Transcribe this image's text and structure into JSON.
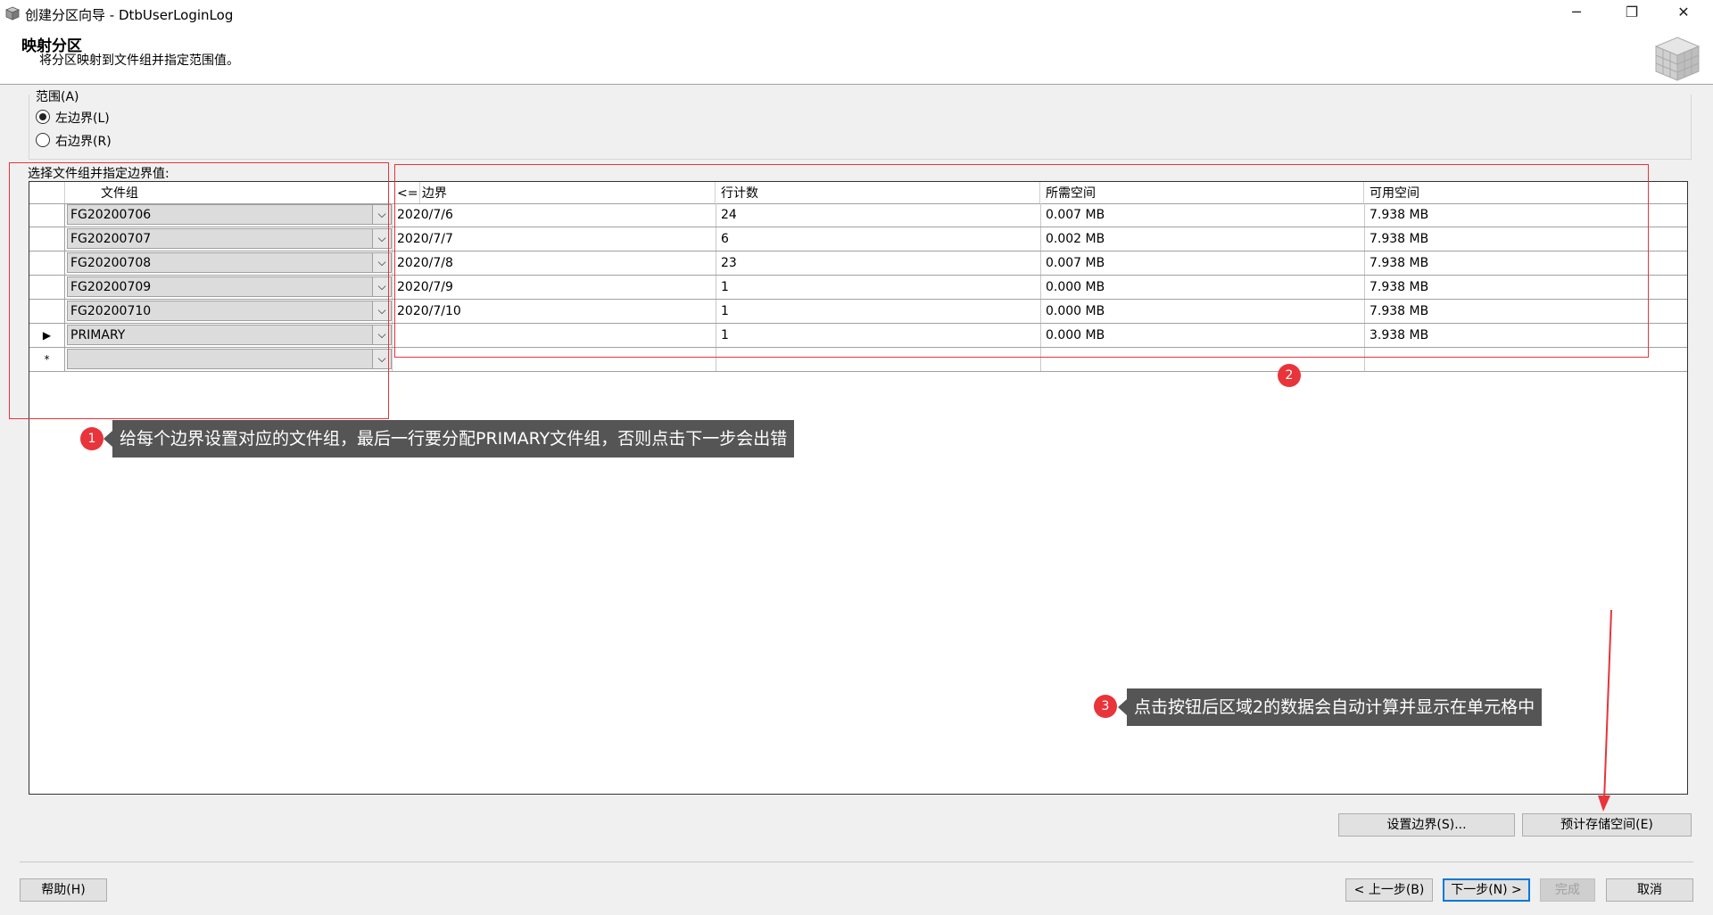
{
  "window": {
    "title": "创建分区向导 - DtbUserLoginLog",
    "minimize": "─",
    "restore": "❐",
    "close": "✕"
  },
  "header": {
    "title": "映射分区",
    "subtitle": "将分区映射到文件组并指定范围值。"
  },
  "range": {
    "title": "范围(A)",
    "options": [
      {
        "label": "左边界(L)",
        "selected": true
      },
      {
        "label": "右边界(R)",
        "selected": false
      }
    ]
  },
  "grid": {
    "label": "选择文件组并指定边界值:",
    "columns": [
      "文件组",
      "<= 边界",
      "行计数",
      "所需空间",
      "可用空间"
    ],
    "rows": [
      {
        "marker": "",
        "filegroup": "FG20200706",
        "boundary": "2020/7/6",
        "rows": "24",
        "required": "0.007 MB",
        "available": "7.938 MB"
      },
      {
        "marker": "",
        "filegroup": "FG20200707",
        "boundary": "2020/7/7",
        "rows": "6",
        "required": "0.002 MB",
        "available": "7.938 MB"
      },
      {
        "marker": "",
        "filegroup": "FG20200708",
        "boundary": "2020/7/8",
        "rows": "23",
        "required": "0.007 MB",
        "available": "7.938 MB"
      },
      {
        "marker": "",
        "filegroup": "FG20200709",
        "boundary": "2020/7/9",
        "rows": "1",
        "required": "0.000 MB",
        "available": "7.938 MB"
      },
      {
        "marker": "",
        "filegroup": "FG20200710",
        "boundary": "2020/7/10",
        "rows": "1",
        "required": "0.000 MB",
        "available": "7.938 MB"
      },
      {
        "marker": "▶",
        "filegroup": "PRIMARY",
        "boundary": "",
        "rows": "1",
        "required": "0.000 MB",
        "available": "3.938 MB"
      },
      {
        "marker": "*",
        "filegroup": "",
        "boundary": "",
        "rows": "",
        "required": "",
        "available": ""
      }
    ],
    "dropdown_glyph": "⌵"
  },
  "annotations": {
    "badge1": "1",
    "note1": "给每个边界设置对应的文件组，最后一行要分配PRIMARY文件组，否则点击下一步会出错",
    "badge2": "2",
    "badge3": "3",
    "note3": "点击按钮后区域2的数据会自动计算并显示在单元格中",
    "accent_color": "#e8343a"
  },
  "buttons": {
    "set_boundaries": "设置边界(S)...",
    "estimate_storage": "预计存储空间(E)",
    "help": "帮助(H)",
    "back": "< 上一步(B)",
    "next": "下一步(N) >",
    "finish": "完成",
    "cancel": "取消"
  }
}
